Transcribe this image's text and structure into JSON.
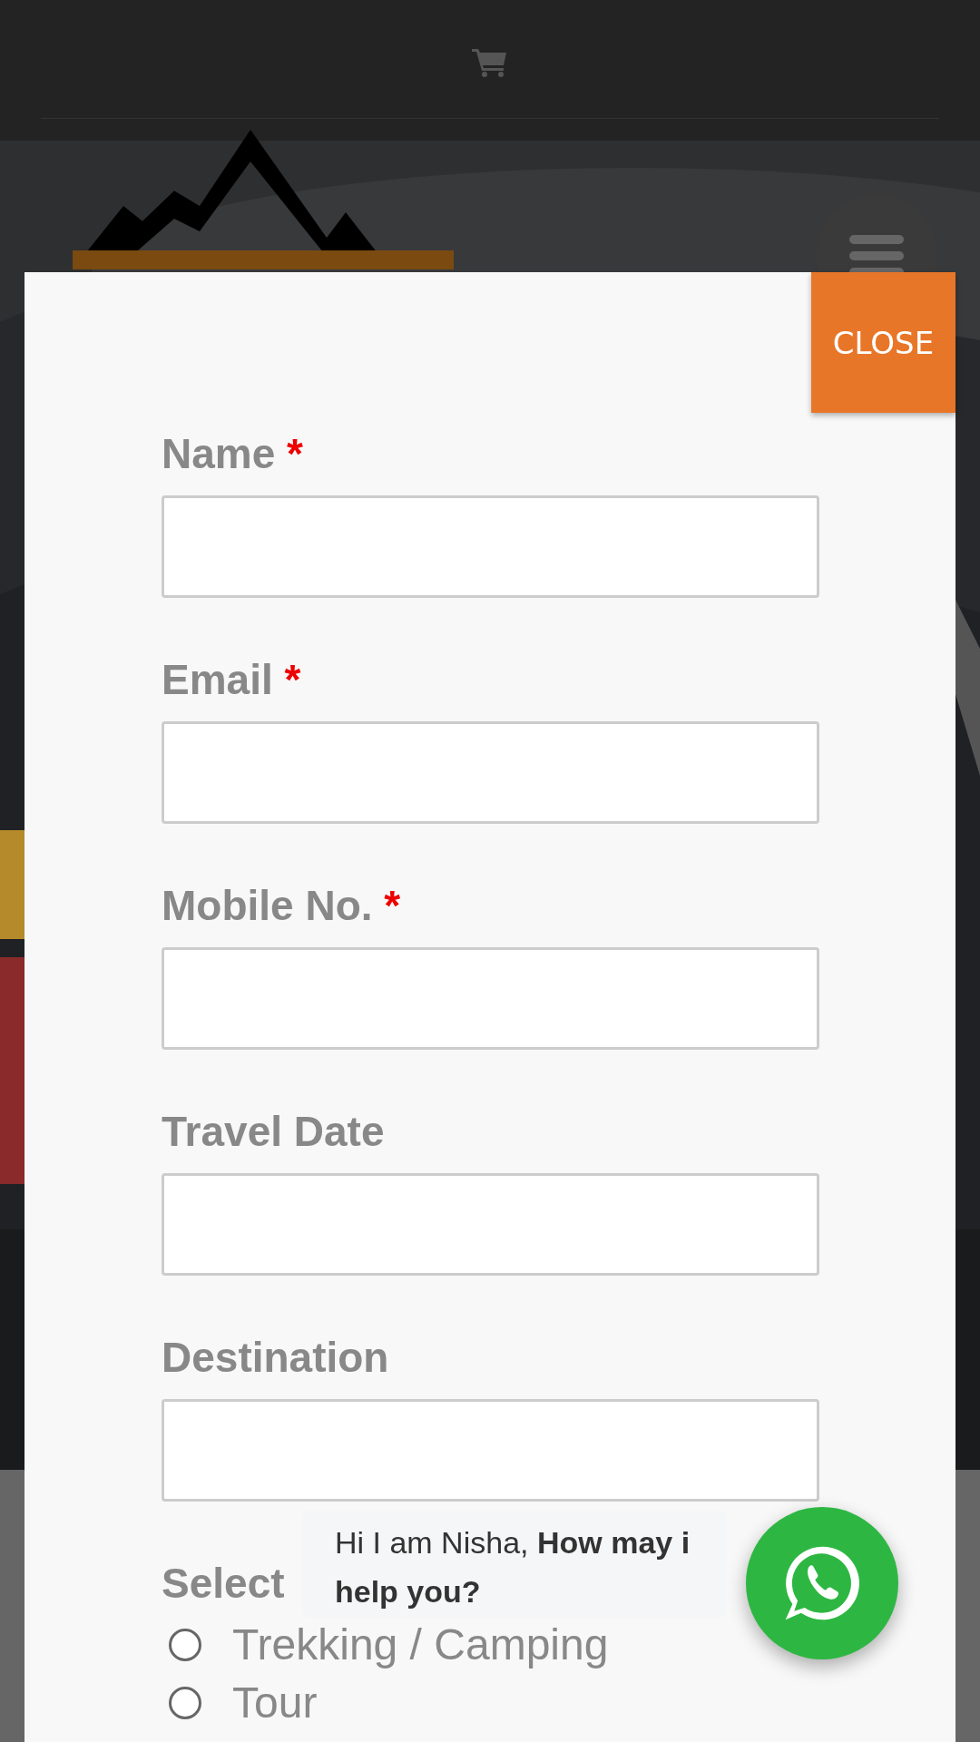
{
  "close_button": "CLOSE",
  "fields": [
    {
      "label": "Name",
      "marker": "*"
    },
    {
      "label": "Email",
      "marker": "*"
    },
    {
      "label": "Mobile No.",
      "marker": "*"
    },
    {
      "label": "Travel Date"
    },
    {
      "label": "Destination"
    }
  ],
  "select": {
    "label": "Select",
    "options": [
      {
        "label": "Trekking / Camping",
        "selected": false
      },
      {
        "label": "Tour",
        "selected": false
      }
    ]
  },
  "chat": {
    "text": "Hi I am Nisha, **How may i help you?**"
  }
}
